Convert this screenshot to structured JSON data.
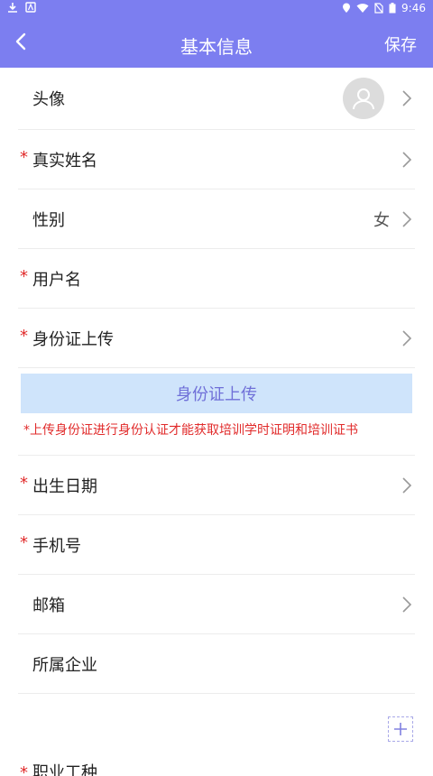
{
  "status_bar": {
    "time": "9:46"
  },
  "nav": {
    "title": "基本信息",
    "save_label": "保存"
  },
  "rows": {
    "avatar": {
      "label": "头像"
    },
    "real_name": {
      "required": "*",
      "label": "真实姓名"
    },
    "gender": {
      "label": "性别",
      "value": "女"
    },
    "username": {
      "required": "*",
      "label": "用户名"
    },
    "id_upload": {
      "required": "*",
      "label": "身份证上传"
    },
    "birth_date": {
      "required": "*",
      "label": "出生日期"
    },
    "phone": {
      "required": "*",
      "label": "手机号"
    },
    "email": {
      "label": "邮箱"
    },
    "company": {
      "label": "所属企业"
    }
  },
  "upload_button": {
    "label": "身份证上传"
  },
  "notice": "*上传身份证进行身份认证才能获取培训学时证明和培训证书",
  "partial_row": {
    "required": "*",
    "label": "职业工种"
  },
  "colors": {
    "primary": "#7c7ef0",
    "required": "#e12b2b",
    "upload_bg": "#cfe4fb"
  }
}
